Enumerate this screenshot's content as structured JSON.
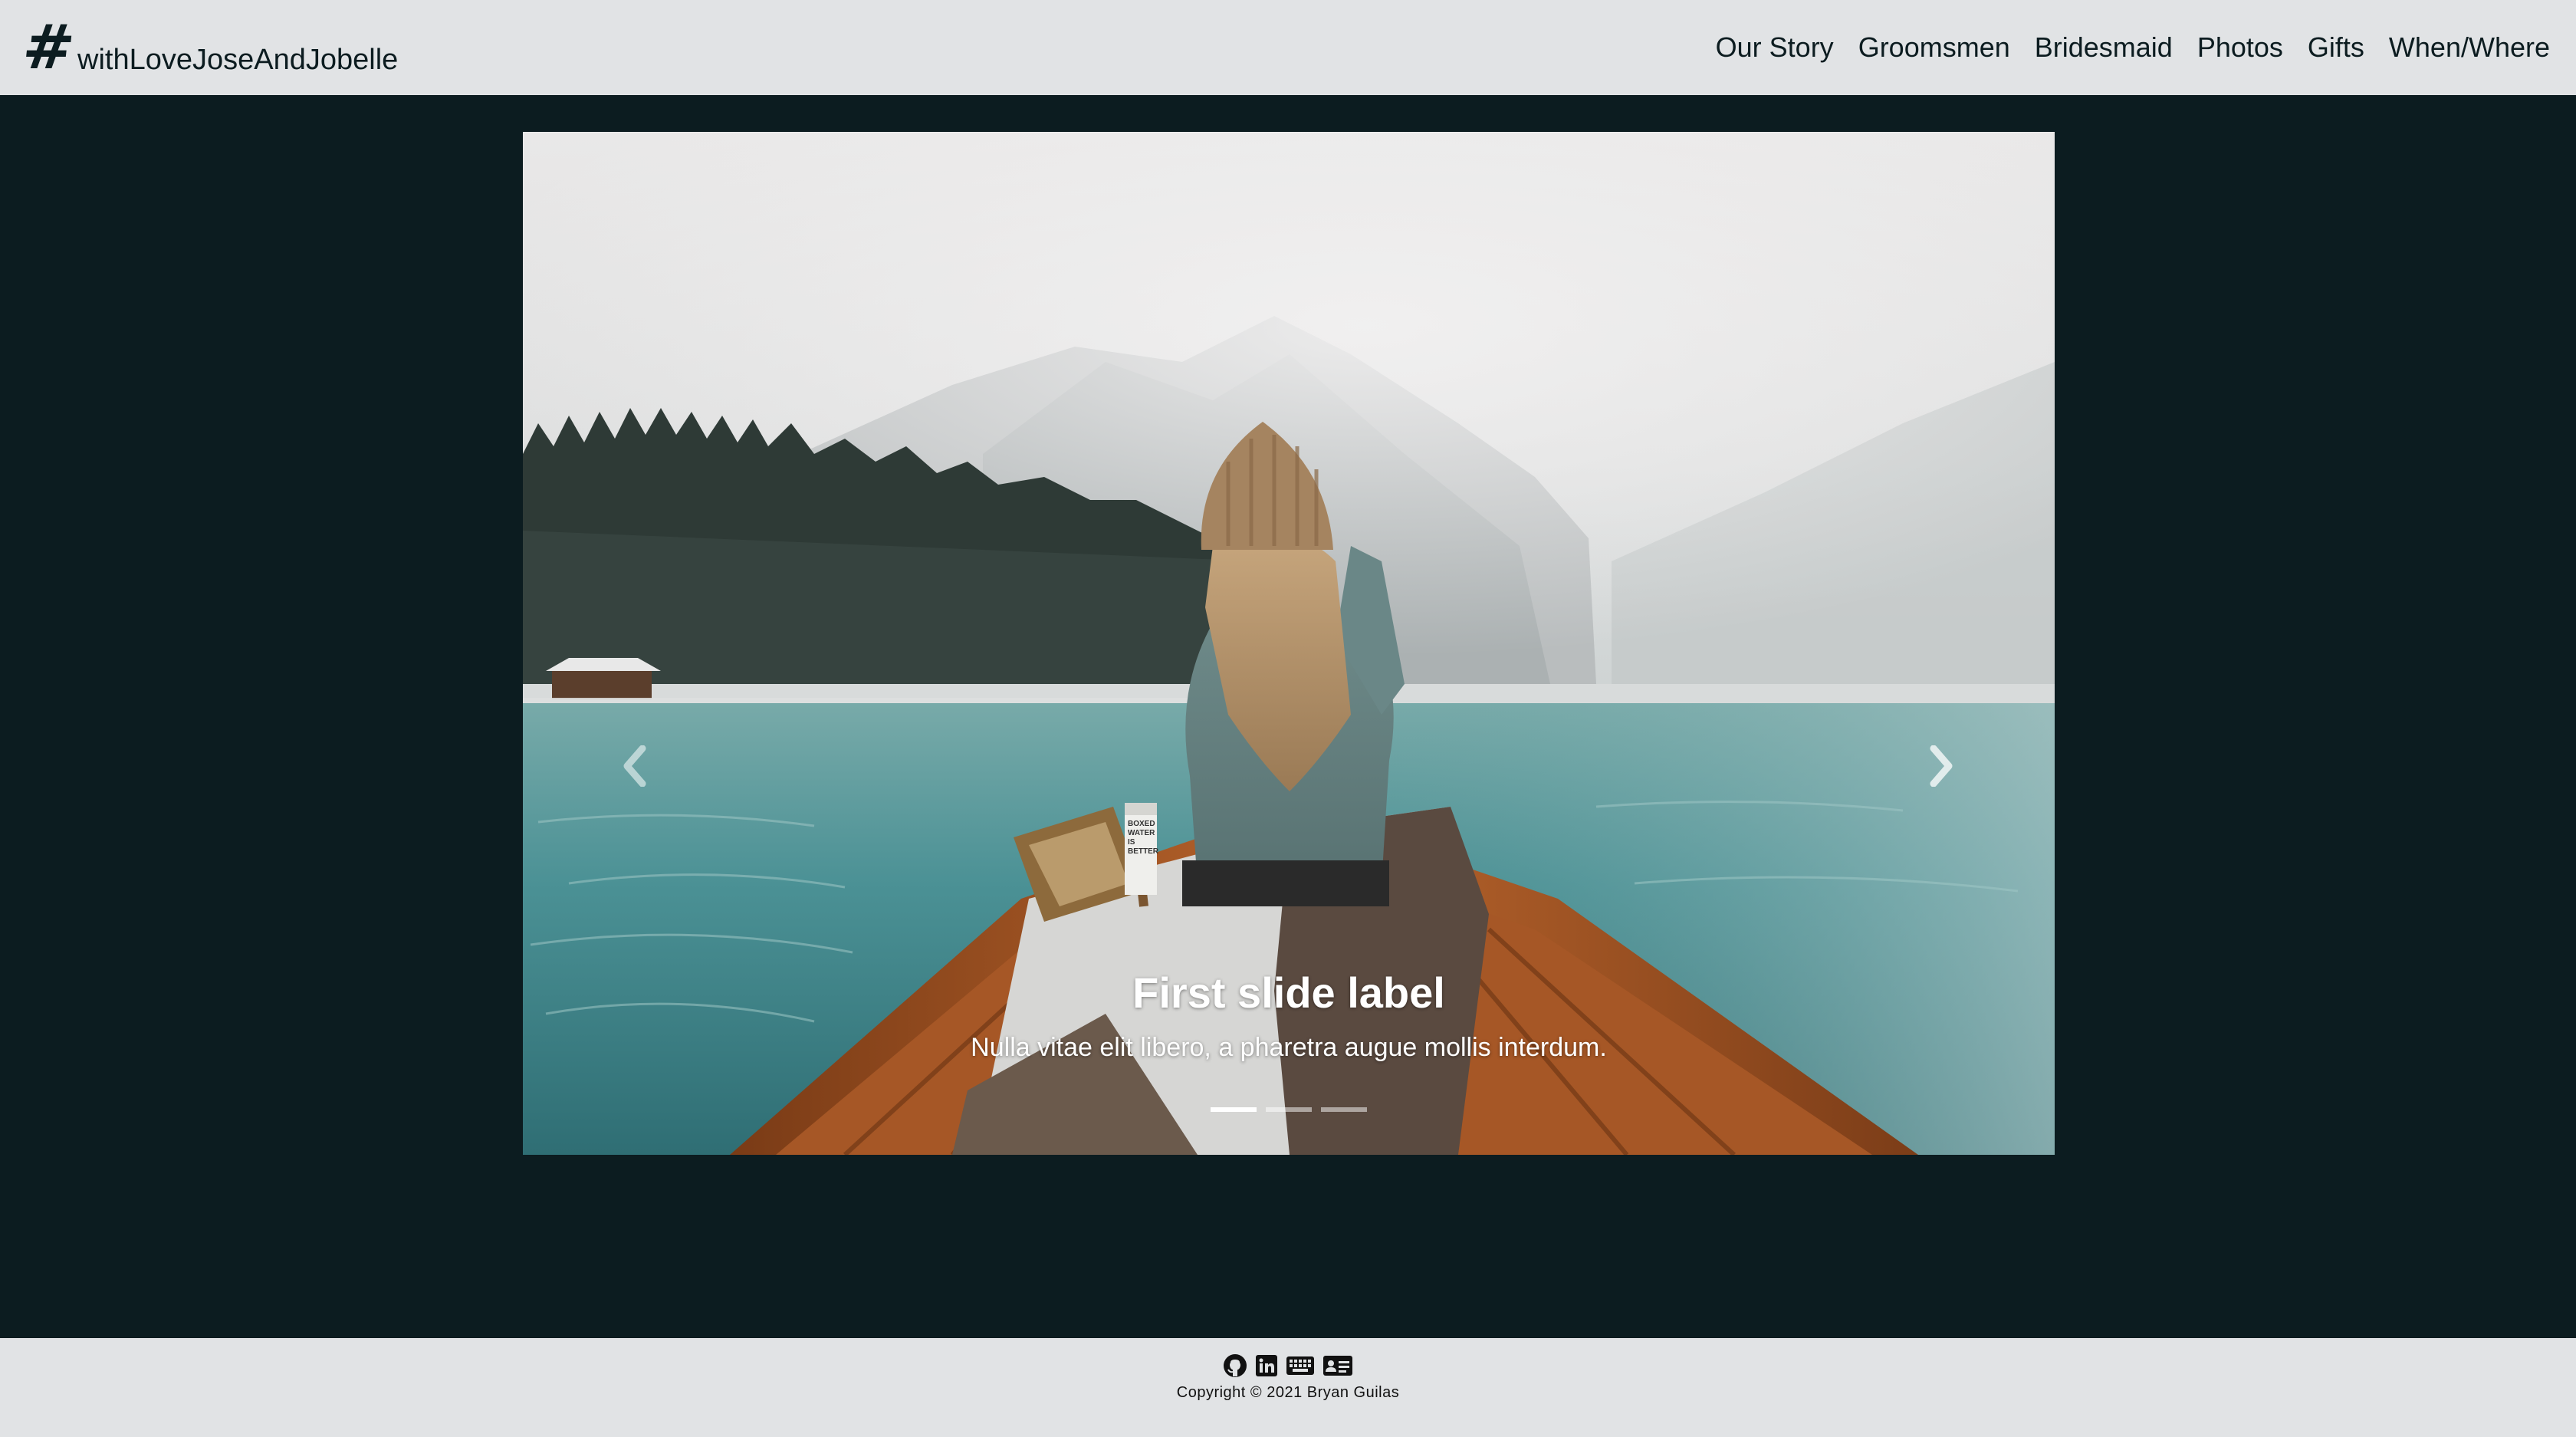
{
  "navbar": {
    "brand_hash": "#",
    "brand_text": "withLoveJoseAndJobelle",
    "links": [
      "Our Story",
      "Groomsmen",
      "Bridesmaid",
      "Photos",
      "Gifts",
      "When/Where"
    ]
  },
  "carousel": {
    "slide": {
      "title": "First slide label",
      "text": "Nulla vitae elit libero, a pharetra augue mollis interdum."
    },
    "prev_icon": "chevron-left-icon",
    "next_icon": "chevron-right-icon",
    "indicator_count": 3,
    "active_indicator": 0,
    "carton_text": [
      "BOXED",
      "WATER",
      "IS",
      "BETTER"
    ]
  },
  "footer": {
    "icons": [
      "github-icon",
      "linkedin-icon",
      "keyboard-icon",
      "id-card-icon"
    ],
    "copyright": "Copyright © 2021 Bryan Guilas"
  },
  "colors": {
    "page_bg": "#0c1c20",
    "navbar_bg": "#e1e3e5",
    "footer_bg": "#e1e3e5",
    "text_dark": "#0c1c20",
    "caption_text": "#ffffff"
  }
}
